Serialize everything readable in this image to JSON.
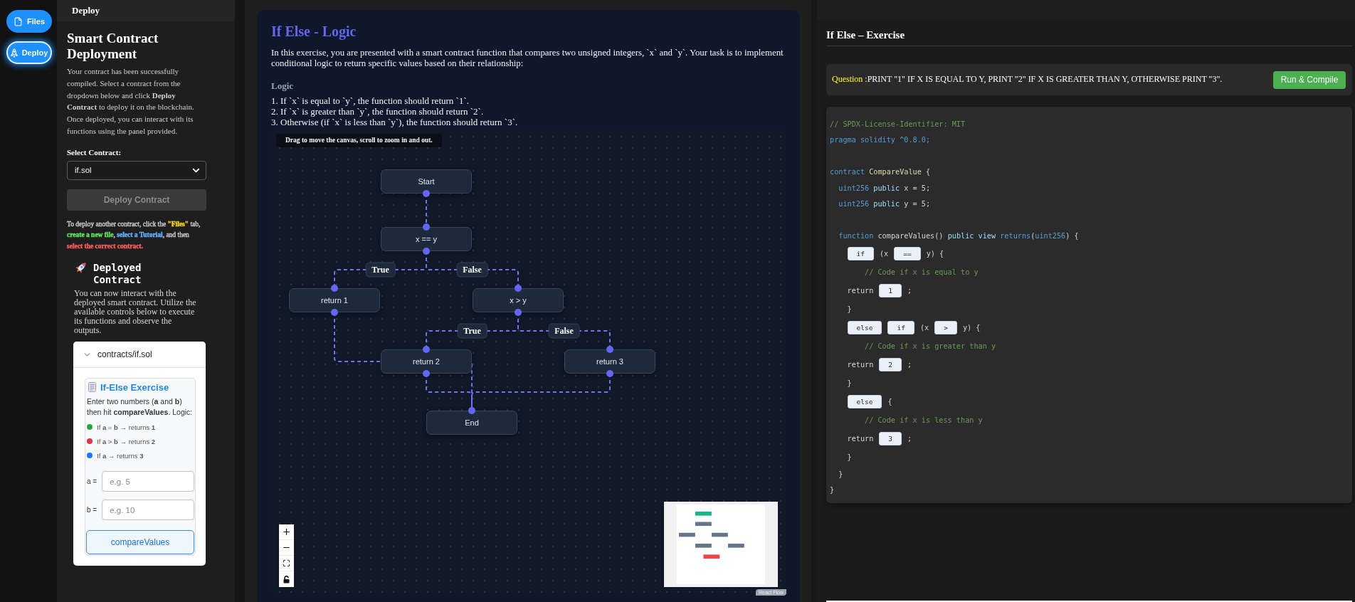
{
  "rail": {
    "tabs": [
      {
        "label": "Files",
        "selected": false
      },
      {
        "label": "Deploy",
        "selected": true
      }
    ]
  },
  "sidebar": {
    "header": "Deploy",
    "title": "Smart Contract Deployment",
    "intro": "Your contract has been successfully compiled. Select a contract from the dropdown below and click **Deploy Contract** to deploy it on the blockchain. Once deployed, you can interact with its functions using the panel provided.",
    "select_label": "Select Contract:",
    "select": {
      "value": "if.sol"
    },
    "deploy_button": {
      "label": "Deploy Contract",
      "disabled": true
    },
    "hint": [
      {
        "text": "To deploy another contract, click the "
      },
      {
        "text": "**\"Files\"**",
        "color": "#ffd700"
      },
      {
        "text": " tab, "
      },
      {
        "text": "**create a new file**",
        "color": "#5ce65c"
      },
      {
        "text": ", "
      },
      {
        "text": "**select a Tutorial**",
        "color": "#5fb3ff"
      },
      {
        "text": ", and then "
      },
      {
        "text": "**select the correct contract.**",
        "color": "#ff5c5c"
      }
    ],
    "deployed": {
      "title": "Deployed Contract",
      "text": "You can now interact with the deployed smart contract. Utilize the available controls below to execute its functions and observe the outputs.",
      "contract": {
        "path": "contracts/if.sol",
        "expanded": true,
        "exercise": {
          "title": "If-Else Exercise",
          "text": "Enter two numbers (**a** and **b**) then hit **compareValues**. Logic:",
          "rules": [
            {
              "text": "If **a** = **b** → returns **1**",
              "color": "#28a745"
            },
            {
              "text": "If **a** > **b** → returns **2**",
              "color": "#dc3545"
            },
            {
              "text": "If **a** → returns **3**",
              "color": "#1a7cf5"
            }
          ],
          "inputs": [
            {
              "label": "a =",
              "placeholder": "e.g. 5"
            },
            {
              "label": "b =",
              "placeholder": "e.g. 10"
            }
          ],
          "button": "compareValues"
        }
      }
    }
  },
  "lesson": {
    "title": "If Else - Logic",
    "intro": "In this exercise, you are presented with a smart contract function that compares two unsigned integers, `x` and `y`. Your task is to implement conditional logic to return specific values based on their relationship:",
    "logic_heading": "Logic",
    "logic_steps": [
      "1. If `x` is equal to `y`, the function should return `1`.",
      "2. If `x` is greater than `y`, the function should return `2`.",
      "3. Otherwise (if `x` is less than `y`), the function should return `3`."
    ],
    "flow": {
      "hint": "Drag to move the canvas, scroll to zoom in and out.",
      "nodes": [
        {
          "label": "Start",
          "color": "#10b981"
        },
        {
          "label": "x == y",
          "color": "#64748b"
        },
        {
          "label": "return 1",
          "color": "#64748b"
        },
        {
          "label": "x > y",
          "color": "#64748b"
        },
        {
          "label": "return 2",
          "color": "#64748b"
        },
        {
          "label": "return 3",
          "color": "#64748b"
        },
        {
          "label": "End",
          "color": "#ef4444"
        }
      ],
      "edge_labels": [
        "True",
        "False",
        "True",
        "False"
      ],
      "attribution": "React Flow"
    }
  },
  "exercise": {
    "title": "If Else – Exercise",
    "question": {
      "label": "Question :",
      "text": "PRINT \"1\" IF X IS EQUAL TO Y, PRINT \"2\" IF X IS GREATER THAN Y, OTHERWISE PRINT \"3\"."
    },
    "run_button": "Run & Compile",
    "code": {
      "lines": [
        {
          "kind": "code",
          "tokens": [
            {
              "kind": "comment",
              "text": "// SPDX-License-Identifier: MIT"
            }
          ]
        },
        {
          "kind": "code",
          "tokens": [
            {
              "kind": "keyword",
              "text": "pragma solidity ^0.8.0;"
            }
          ]
        },
        {
          "kind": "empty"
        },
        {
          "kind": "code",
          "tokens": [
            {
              "kind": "keyword",
              "text": "contract"
            },
            {
              "kind": "name",
              "text": " CompareValue"
            },
            {
              "kind": "plain",
              "text": " {"
            }
          ],
          "children": [
            {
              "kind": "code",
              "tokens": [
                {
                  "kind": "keyword",
                  "text": "uint256"
                },
                {
                  "kind": "modifier",
                  "text": " public"
                },
                {
                  "kind": "plain",
                  "text": " x = 5;"
                }
              ]
            },
            {
              "kind": "code",
              "tokens": [
                {
                  "kind": "keyword",
                  "text": "uint256"
                },
                {
                  "kind": "modifier",
                  "text": " public"
                },
                {
                  "kind": "plain",
                  "text": " y = 5;"
                }
              ]
            },
            {
              "kind": "empty"
            },
            {
              "kind": "code",
              "tokens": [
                {
                  "kind": "keyword",
                  "text": "function"
                },
                {
                  "kind": "plain",
                  "text": " compareValues() "
                },
                {
                  "kind": "modifier",
                  "text": "public view"
                },
                {
                  "kind": "keyword",
                  "text": " returns"
                },
                {
                  "kind": "plain",
                  "text": "("
                },
                {
                  "kind": "keyword",
                  "text": "uint256"
                },
                {
                  "kind": "plain",
                  "text": ") {"
                }
              ],
              "children": [
                {
                  "kind": "code",
                  "tokens": [
                    {
                      "kind": "blank",
                      "value": "if"
                    },
                    {
                      "kind": "plain",
                      "text": "(x"
                    },
                    {
                      "kind": "blank",
                      "value": "=="
                    },
                    {
                      "kind": "plain",
                      "text": "y) {"
                    }
                  ],
                  "children": [
                    {
                      "kind": "code",
                      "tokens": [
                        {
                          "kind": "comment",
                          "text": "// Code if x is equal to y"
                        }
                      ]
                    }
                  ]
                },
                {
                  "kind": "code",
                  "tokens": [
                    {
                      "kind": "plain",
                      "text": "return"
                    },
                    {
                      "kind": "blank",
                      "value": "1"
                    },
                    {
                      "kind": "plain",
                      "text": ";"
                    }
                  ]
                },
                {
                  "kind": "code",
                  "tokens": [
                    {
                      "kind": "plain",
                      "text": "}"
                    }
                  ]
                },
                {
                  "kind": "code",
                  "tokens": [
                    {
                      "kind": "blank",
                      "value": "else"
                    },
                    {
                      "kind": "blank",
                      "value": "if"
                    },
                    {
                      "kind": "plain",
                      "text": "(x"
                    },
                    {
                      "kind": "blank",
                      "value": ">"
                    },
                    {
                      "kind": "plain",
                      "text": "y) {"
                    }
                  ],
                  "children": [
                    {
                      "kind": "code",
                      "tokens": [
                        {
                          "kind": "comment",
                          "text": "// Code if x is greater than y"
                        }
                      ]
                    }
                  ]
                },
                {
                  "kind": "code",
                  "tokens": [
                    {
                      "kind": "plain",
                      "text": "return"
                    },
                    {
                      "kind": "blank",
                      "value": "2"
                    },
                    {
                      "kind": "plain",
                      "text": ";"
                    }
                  ]
                },
                {
                  "kind": "code",
                  "tokens": [
                    {
                      "kind": "plain",
                      "text": "}"
                    }
                  ]
                },
                {
                  "kind": "code",
                  "tokens": [
                    {
                      "kind": "blank",
                      "value": "else"
                    },
                    {
                      "kind": "plain",
                      "text": "{"
                    }
                  ],
                  "children": [
                    {
                      "kind": "code",
                      "tokens": [
                        {
                          "kind": "comment",
                          "text": "// Code if x is less than y"
                        }
                      ]
                    }
                  ]
                },
                {
                  "kind": "code",
                  "tokens": [
                    {
                      "kind": "plain",
                      "text": "return"
                    },
                    {
                      "kind": "blank",
                      "value": "3"
                    },
                    {
                      "kind": "plain",
                      "text": ";"
                    }
                  ]
                },
                {
                  "kind": "code",
                  "tokens": [
                    {
                      "kind": "plain",
                      "text": "}"
                    }
                  ]
                }
              ]
            },
            {
              "kind": "code",
              "tokens": [
                {
                  "kind": "plain",
                  "text": "}"
                }
              ]
            }
          ]
        },
        {
          "kind": "code",
          "tokens": [
            {
              "kind": "plain",
              "text": "}"
            }
          ]
        }
      ]
    }
  }
}
